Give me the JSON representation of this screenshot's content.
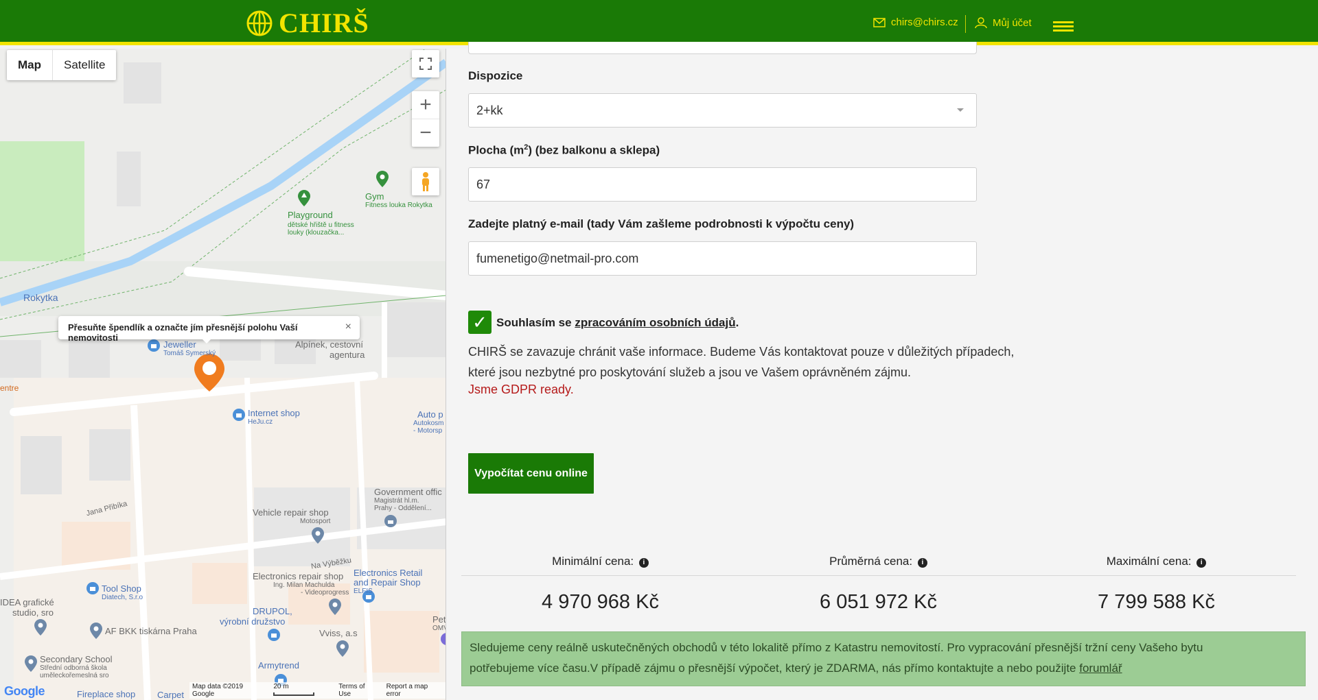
{
  "header": {
    "logo_text": "CHIRŠ",
    "email": "chirs@chirs.cz",
    "account": "Můj účet",
    "accent_color": "#f2e400",
    "brand_color": "#1a7a06"
  },
  "map": {
    "type_map": "Map",
    "type_satellite": "Satellite",
    "zoom_in": "+",
    "zoom_out": "−",
    "tooltip": "Přesuňte špendlík a označte jím přesnější polohu Vaší nemovitosti",
    "tooltip_close": "×",
    "labels": {
      "rokytka": "Rokytka",
      "gym": "Gym",
      "gym_sub": "Fitness louka Rokytka",
      "playground": "Playground",
      "playground_sub1": "dětské hřiště u fitness",
      "playground_sub2": "louky (klouzačka...",
      "jeweller": "Jeweller",
      "jeweller_sub": "Tomáš Symerský",
      "alpinek1": "Alpínek, cestovní",
      "alpinek2": "agentura",
      "entre": "entre",
      "internet_shop": "Internet shop",
      "internet_shop_sub": "HeJu.cz",
      "auto": "Auto p",
      "auto_sub1": "Autokosm",
      "auto_sub2": "- Motorsp",
      "government": "Government offic",
      "government_sub1": "Magistrát hl.m.",
      "government_sub2": "Prahy - Oddělení...",
      "jana_pribika": "Jana Přibíka",
      "vehicle_repair": "Vehicle repair shop",
      "vehicle_repair_sub": "Motosport",
      "na_vybezku": "Na Výběžku",
      "electronics_retail1": "Electronics Retail",
      "electronics_retail2": "and Repair Shop",
      "electronics_retail_sub": "ELFIS",
      "electronics_repair": "Electronics repair shop",
      "electronics_repair_sub1": "Ing. Milan Machulda",
      "electronics_repair_sub2": "- Videoprogress",
      "tool_shop": "Tool Shop",
      "tool_shop_sub": "Diatech, S.r.o",
      "idea1": "IDEA grafické",
      "idea2": "studio, sro",
      "drupol1": "DRUPOL,",
      "drupol2": "výrobní družstvo",
      "af_bkk": "AF BKK tiskárna Praha",
      "vviss": "Vviss, a.s",
      "secondary_school": "Secondary School",
      "secondary_sub1": "Střední odborná škola",
      "secondary_sub2": "uměleckořemeslná sro",
      "armytrend": "Armytrend",
      "pet": "Pet",
      "pet_sub": "OMV",
      "fireplace": "Fireplace shop",
      "carpet": "Carpet"
    },
    "footer": {
      "google": "Google",
      "map_data": "Map data ©2019 Google",
      "scale": "20 m",
      "terms": "Terms of Use",
      "report": "Report a map error"
    }
  },
  "form": {
    "dispozice_label": "Dispozice",
    "dispozice_value": "2+kk",
    "plocha_label_pre": "Plocha (m",
    "plocha_label_sup": "2",
    "plocha_label_post": ") (bez balkonu a sklepa)",
    "plocha_value": "67",
    "email_label": "Zadejte platný e-mail (tady Vám zašleme podrobnosti k výpočtu ceny)",
    "email_value": "fumenetigo@netmail-pro.com",
    "checkbox_checked": true,
    "consent_pre": "Souhlasím se ",
    "consent_link": "zpracováním osobních údajů",
    "consent_post": ".",
    "note_line1": "CHIRŠ se zavazuje chránit vaše informace. Budeme Vás kontaktovat pouze v důležitých případech,",
    "note_line2": "které jsou nezbytné pro poskytování služeb a jsou ve Vašem oprávněném zájmu.",
    "gdpr": "Jsme GDPR ready.",
    "submit": "Vypočítat cenu online"
  },
  "prices": {
    "min_label": "Minimální cena:",
    "avg_label": "Průměrná cena:",
    "max_label": "Maximální cena:",
    "min_value": "4 970 968 Kč",
    "avg_value": "6 051 972 Kč",
    "max_value": "7 799 588 Kč"
  },
  "info": {
    "text_line1": "Sledujeme ceny reálně uskutečněných obchodů v této lokalitě přímo z Katastru nemovitostí. Pro vypracování přesnější tržní ceny Vašeho bytu",
    "text_line2": "potřebujeme více času.V případě zájmu o přesnější výpočet, který je ZDARMA, nás přímo kontaktujte a nebo použijte ",
    "link": "forumlář"
  }
}
